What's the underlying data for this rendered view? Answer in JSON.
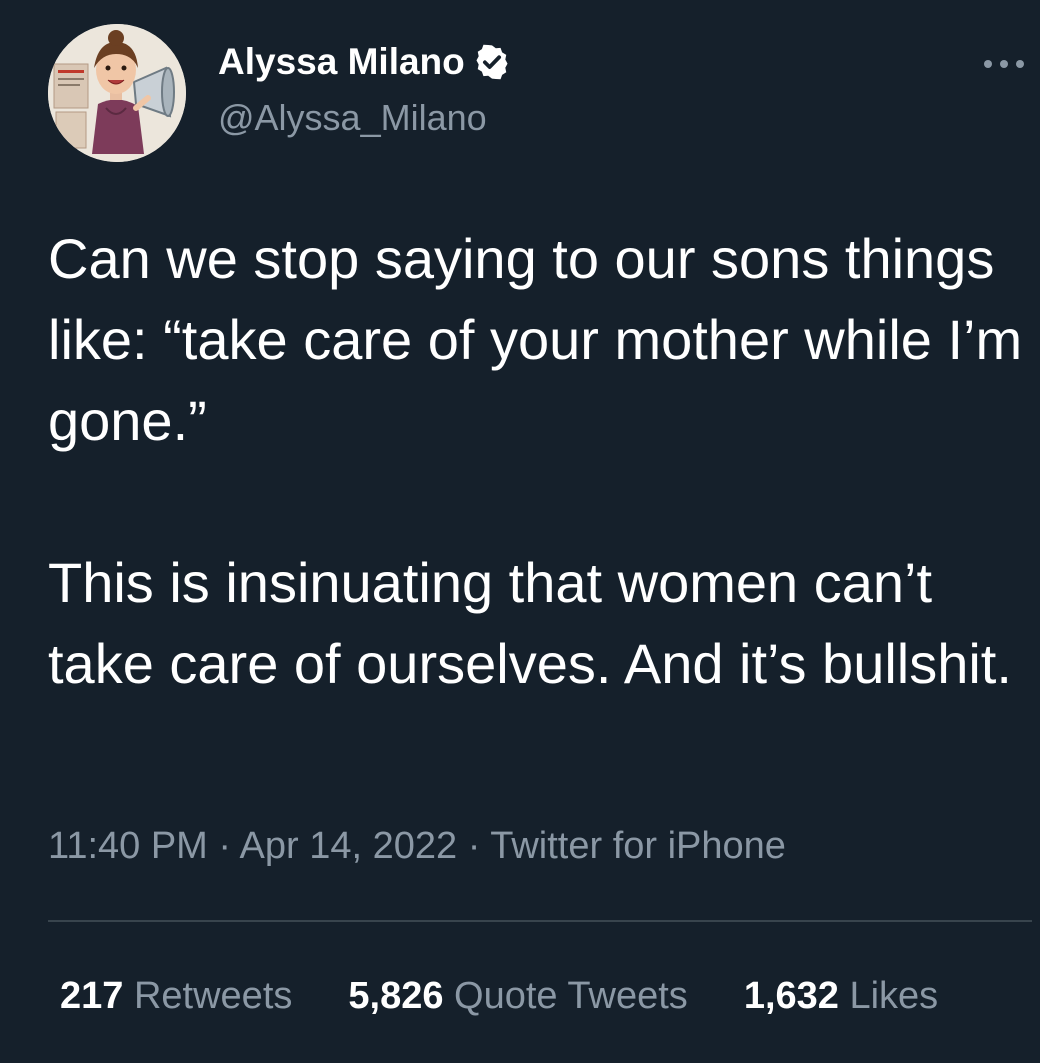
{
  "author": {
    "display_name": "Alyssa Milano",
    "handle": "@Alyssa_Milano",
    "verified": true,
    "avatar_icon": "caricature-avatar-icon"
  },
  "tweet": {
    "paragraphs": [
      "Can we stop saying to our sons things like: “take care of your mother while I’m gone.”",
      "This is insinuating that women can’t take care of ourselves. And it’s bullshit."
    ],
    "time": "11:40 PM",
    "date": "Apr 14, 2022",
    "source": "Twitter for iPhone",
    "separator": "·"
  },
  "stats": {
    "retweets": {
      "count": "217",
      "label": "Retweets"
    },
    "quote_tweets": {
      "count": "5,826",
      "label": "Quote Tweets"
    },
    "likes": {
      "count": "1,632",
      "label": "Likes"
    }
  },
  "colors": {
    "background": "#15202b",
    "text": "#ffffff",
    "secondary": "#8b98a5",
    "divider": "#38444d"
  }
}
